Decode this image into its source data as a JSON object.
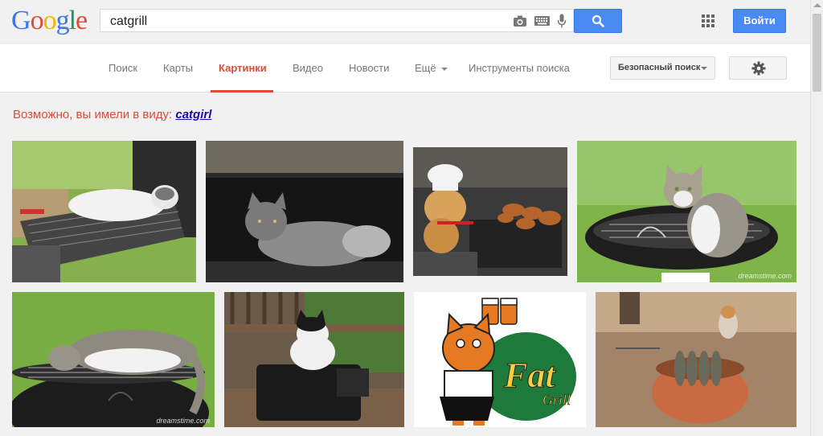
{
  "header": {
    "logo_text": "Google",
    "logo_colors": [
      "#3b77e6",
      "#dd4b39",
      "#f4b400",
      "#3b77e6",
      "#0f9d58",
      "#dd4b39"
    ],
    "search_query": "catgrill",
    "login_label": "Войти"
  },
  "nav": {
    "items": [
      {
        "label": "Поиск",
        "active": false
      },
      {
        "label": "Карты",
        "active": false
      },
      {
        "label": "Картинки",
        "active": true
      },
      {
        "label": "Видео",
        "active": false
      },
      {
        "label": "Новости",
        "active": false
      },
      {
        "label": "Ещё",
        "active": false
      },
      {
        "label": "Инструменты поиска",
        "active": false
      }
    ],
    "safe_search_label": "Безопасный поиск",
    "active_color": "#dd4b39"
  },
  "suggestion": {
    "prefix": "Возможно, вы имели в виду:",
    "term": "catgirl"
  },
  "results": {
    "watermarks": [
      "dreamstime.com",
      "dreamstime.com"
    ],
    "fat_grill_logo": {
      "word1": "Fat",
      "word2": "Grill"
    }
  },
  "colors": {
    "accent_blue": "#4a8af4",
    "suggestion_link": "#1a0dab"
  }
}
